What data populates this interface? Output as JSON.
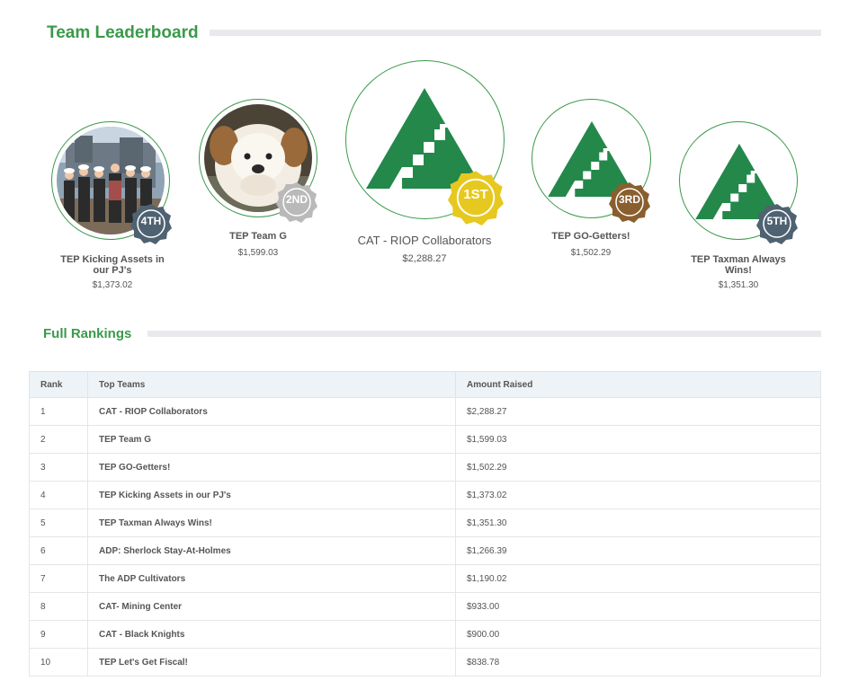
{
  "leaderboard": {
    "title": "Team Leaderboard",
    "podium": [
      {
        "place": "4TH",
        "name": "TEP Kicking Assets in our PJ's",
        "amount": "$1,373.02",
        "badge_color": "#4f6272",
        "avatar": "team-photo"
      },
      {
        "place": "2ND",
        "name": "TEP Team G",
        "amount": "$1,599.03",
        "badge_color": "#b9b9b9",
        "avatar": "plush-dog-photo"
      },
      {
        "place": "1ST",
        "name": "CAT - RIOP Collaborators",
        "amount": "$2,288.27",
        "badge_color": "#e7c81f",
        "avatar": "triangle-logo"
      },
      {
        "place": "3RD",
        "name": "TEP GO-Getters!",
        "amount": "$1,502.29",
        "badge_color": "#8a5f2e",
        "avatar": "triangle-logo"
      },
      {
        "place": "5TH",
        "name": "TEP Taxman Always Wins!",
        "amount": "$1,351.30",
        "badge_color": "#4f6272",
        "avatar": "triangle-logo"
      }
    ]
  },
  "rankings": {
    "title": "Full Rankings",
    "headers": {
      "rank": "Rank",
      "team": "Top Teams",
      "amount": "Amount Raised"
    },
    "rows": [
      {
        "rank": "1",
        "team": "CAT - RIOP Collaborators",
        "amount": "$2,288.27"
      },
      {
        "rank": "2",
        "team": "TEP Team G",
        "amount": "$1,599.03"
      },
      {
        "rank": "3",
        "team": "TEP GO-Getters!",
        "amount": "$1,502.29"
      },
      {
        "rank": "4",
        "team": "TEP Kicking Assets in our PJ's",
        "amount": "$1,373.02"
      },
      {
        "rank": "5",
        "team": "TEP Taxman Always Wins!",
        "amount": "$1,351.30"
      },
      {
        "rank": "6",
        "team": "ADP: Sherlock Stay-At-Holmes",
        "amount": "$1,266.39"
      },
      {
        "rank": "7",
        "team": "The ADP Cultivators",
        "amount": "$1,190.02"
      },
      {
        "rank": "8",
        "team": "CAT- Mining Center",
        "amount": "$933.00"
      },
      {
        "rank": "9",
        "team": "CAT - Black Knights",
        "amount": "$900.00"
      },
      {
        "rank": "10",
        "team": "TEP Let's Get Fiscal!",
        "amount": "$838.78"
      }
    ]
  },
  "colors": {
    "brand_green": "#3a9a4a",
    "logo_green": "#23884a"
  }
}
